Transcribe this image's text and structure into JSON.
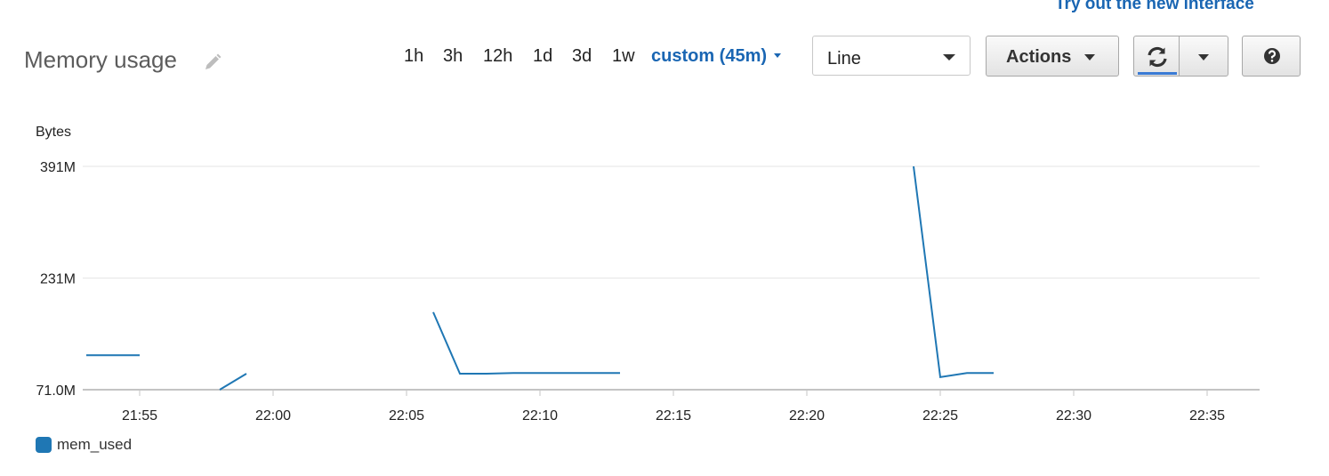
{
  "header": {
    "new_interface_link": "Try out the new interface",
    "title": "Memory usage"
  },
  "time_ranges": [
    "1h",
    "3h",
    "12h",
    "1d",
    "3d",
    "1w"
  ],
  "custom_range": "custom (45m)",
  "view_select": {
    "value": "Line"
  },
  "toolbar": {
    "actions_label": "Actions"
  },
  "icons": {
    "edit": "pencil-icon",
    "refresh": "refresh-icon",
    "refresh_dropdown": "chevron-down-icon",
    "help": "question-circle-icon"
  },
  "colors": {
    "accent": "#1a66b3",
    "series": "#1f77b4",
    "refresh_indicator": "#3a7bd5"
  },
  "chart_data": {
    "type": "line",
    "ylabel": "Bytes",
    "y_ticks": [
      "391M",
      "231M",
      "71.0M"
    ],
    "y_tick_values": [
      391,
      231,
      71
    ],
    "x_ticks": [
      "21:55",
      "22:00",
      "22:05",
      "22:10",
      "22:15",
      "22:20",
      "22:25",
      "22:30",
      "22:35"
    ],
    "ylim": [
      71,
      391
    ],
    "grid": true,
    "legend_position": "bottom-left",
    "series": [
      {
        "name": "mem_used",
        "segments": [
          [
            [
              "21:53",
              120.5
            ],
            [
              "21:55",
              120.5
            ]
          ],
          [
            [
              "21:58",
              71
            ],
            [
              "21:59",
              94
            ]
          ],
          [
            [
              "22:06",
              182
            ],
            [
              "22:07",
              94
            ],
            [
              "22:08",
              94
            ],
            [
              "22:09",
              95
            ],
            [
              "22:13",
              95
            ]
          ],
          [
            [
              "22:24",
              391
            ],
            [
              "22:25",
              89
            ],
            [
              "22:26",
              95
            ],
            [
              "22:27",
              95
            ]
          ]
        ]
      }
    ]
  }
}
